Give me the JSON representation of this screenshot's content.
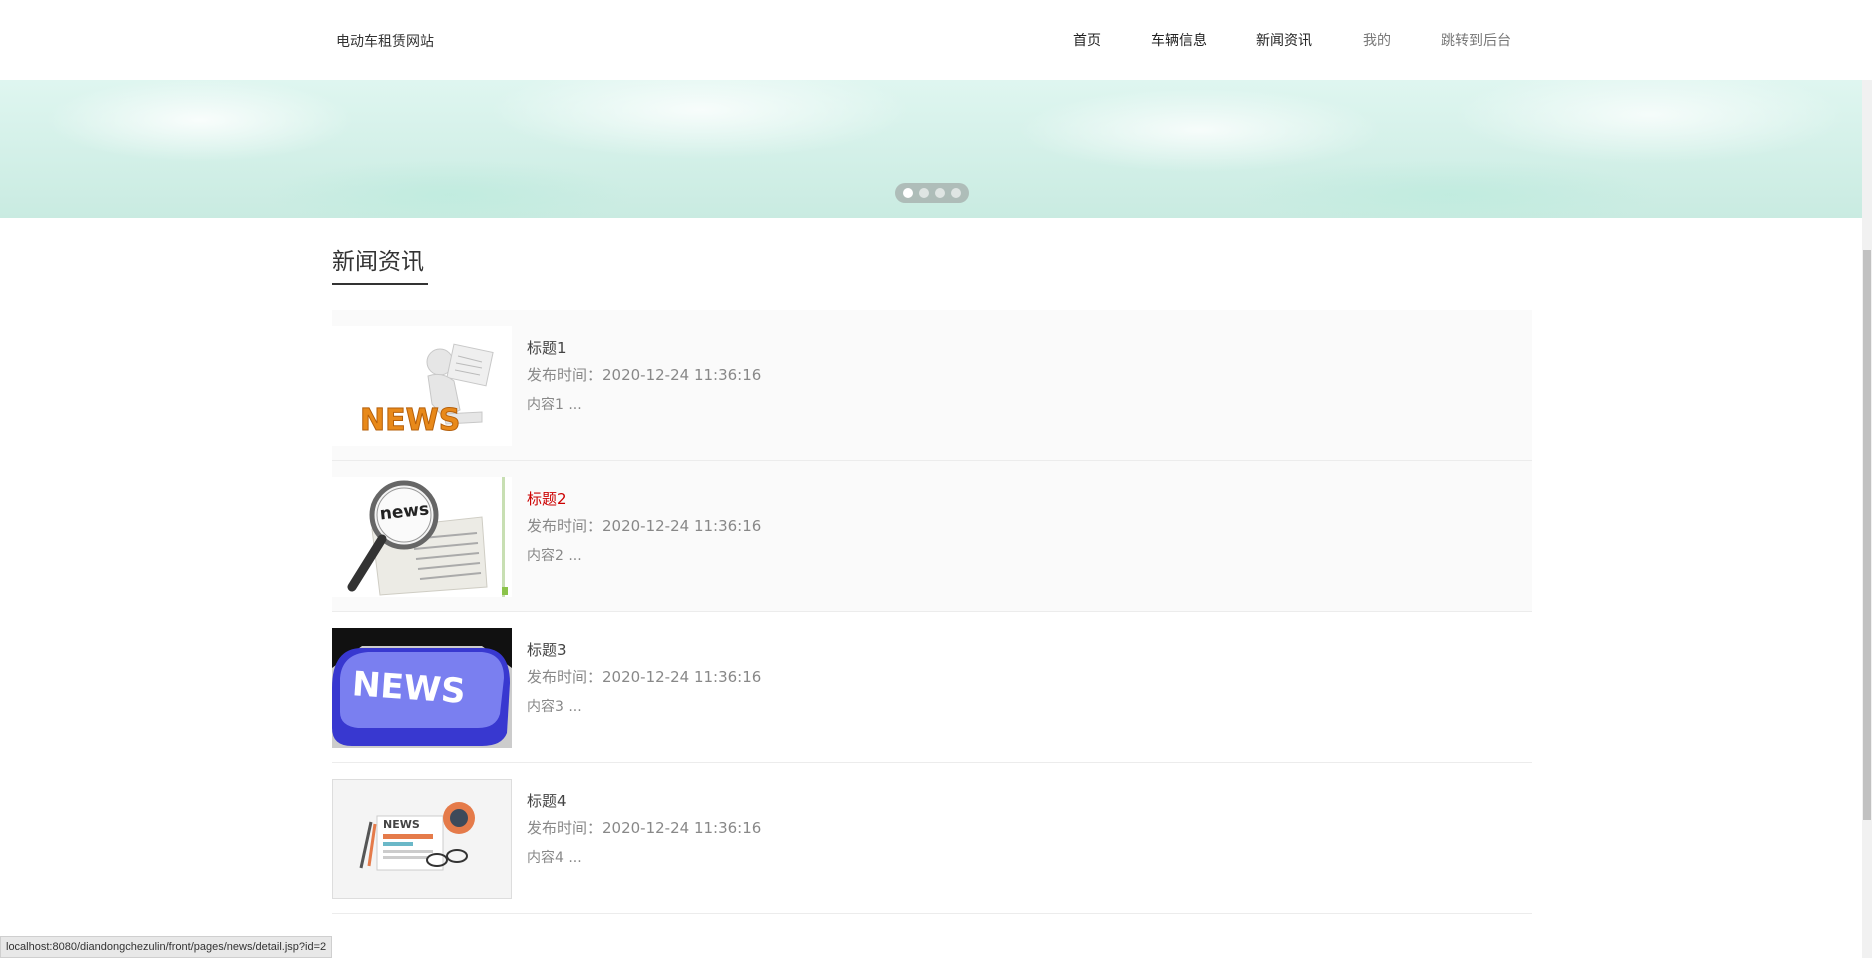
{
  "header": {
    "site_title": "电动车租赁网站",
    "nav": [
      "首页",
      "车辆信息",
      "新闻资讯",
      "我的",
      "跳转到后台"
    ]
  },
  "banner": {
    "slide_count": 4,
    "active_slide": 1
  },
  "section": {
    "title": "新闻资讯"
  },
  "news": [
    {
      "title": "标题1",
      "time": "发布时间：2020-12-24 11:36:16",
      "summary": "内容1 ...",
      "image": "news-reader-figure"
    },
    {
      "title": "标题2",
      "time": "发布时间：2020-12-24 11:36:16",
      "summary": "内容2 ...",
      "image": "magnifier-newspaper"
    },
    {
      "title": "标题3",
      "time": "发布时间：2020-12-24 11:36:16",
      "summary": "内容3 ...",
      "image": "news-keyboard-key"
    },
    {
      "title": "标题4",
      "time": "发布时间：2020-12-24 11:36:16",
      "summary": "内容4 ...",
      "image": "news-flat-illustration"
    }
  ],
  "statusbar": {
    "url": "localhost:8080/diandongchezulin/front/pages/news/detail.jsp?id=2"
  },
  "colors": {
    "hover_title": "#cc0000",
    "accent_underline": "#333333"
  }
}
